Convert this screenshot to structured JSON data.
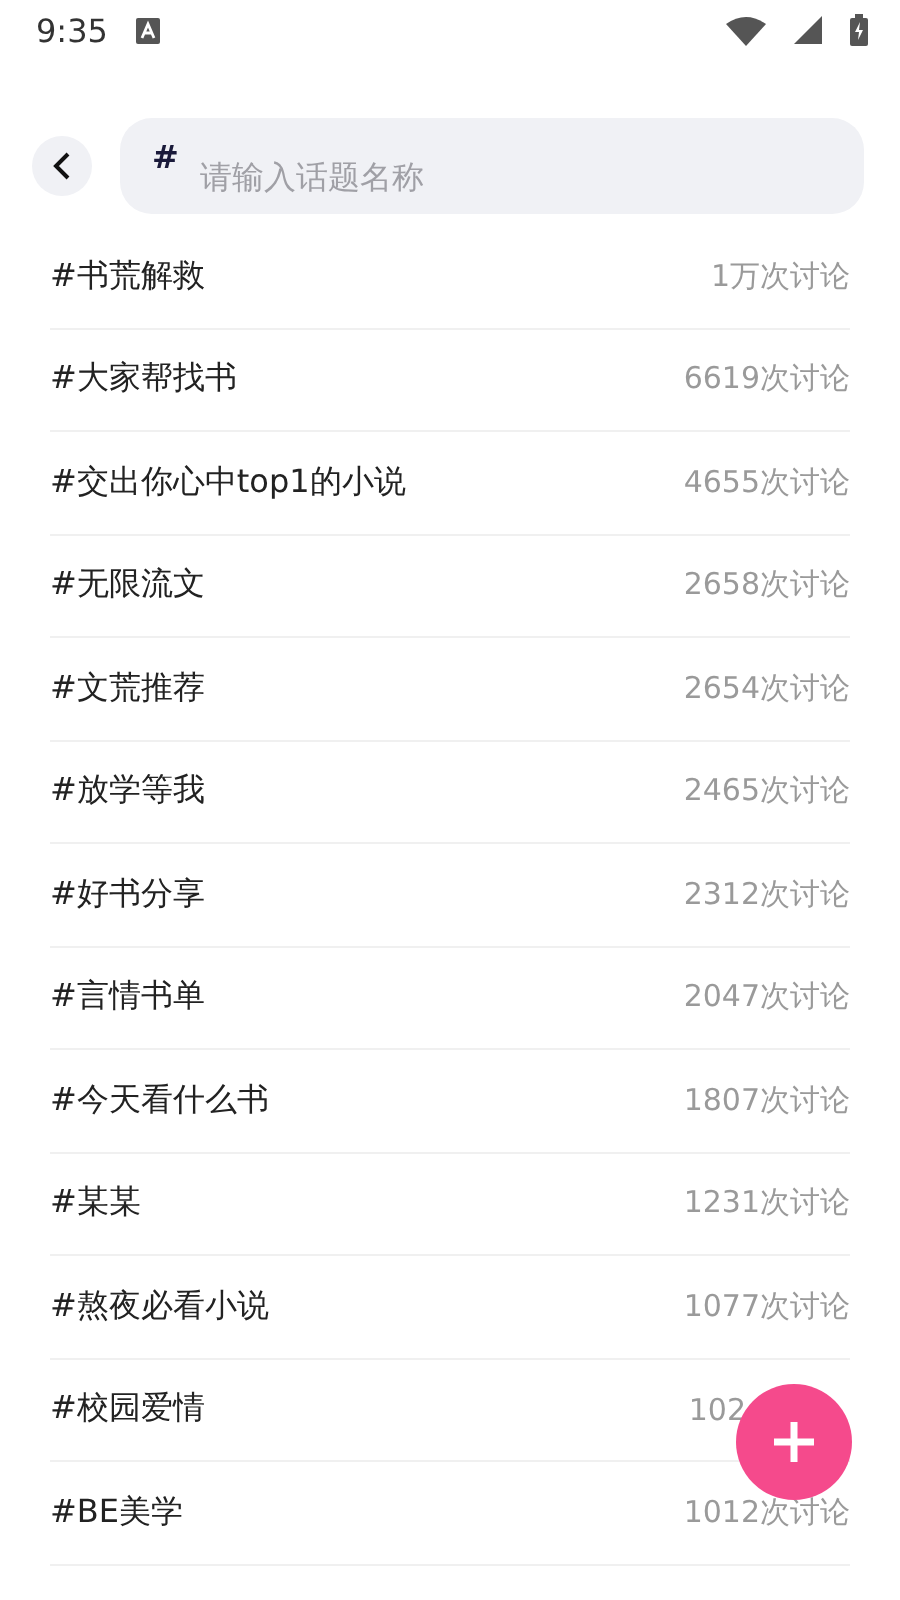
{
  "status_bar": {
    "time": "9:35"
  },
  "search": {
    "prefix": "#",
    "placeholder": "请输入话题名称"
  },
  "topics": [
    {
      "name": "#书荒解救",
      "count": "1万次讨论"
    },
    {
      "name": "#大家帮找书",
      "count": "6619次讨论"
    },
    {
      "name": "#交出你心中top1的小说",
      "count": "4655次讨论"
    },
    {
      "name": "#无限流文",
      "count": "2658次讨论"
    },
    {
      "name": "#文荒推荐",
      "count": "2654次讨论"
    },
    {
      "name": "#放学等我",
      "count": "2465次讨论"
    },
    {
      "name": "#好书分享",
      "count": "2312次讨论"
    },
    {
      "name": "#言情书单",
      "count": "2047次讨论"
    },
    {
      "name": "#今天看什么书",
      "count": "1807次讨论"
    },
    {
      "name": "#某某",
      "count": "1231次讨论"
    },
    {
      "name": "#熬夜必看小说",
      "count": "1077次讨论"
    },
    {
      "name": "#校园爱情",
      "count": "102",
      "covered": true
    },
    {
      "name": "#BE美学",
      "count": "1012次讨论"
    }
  ]
}
